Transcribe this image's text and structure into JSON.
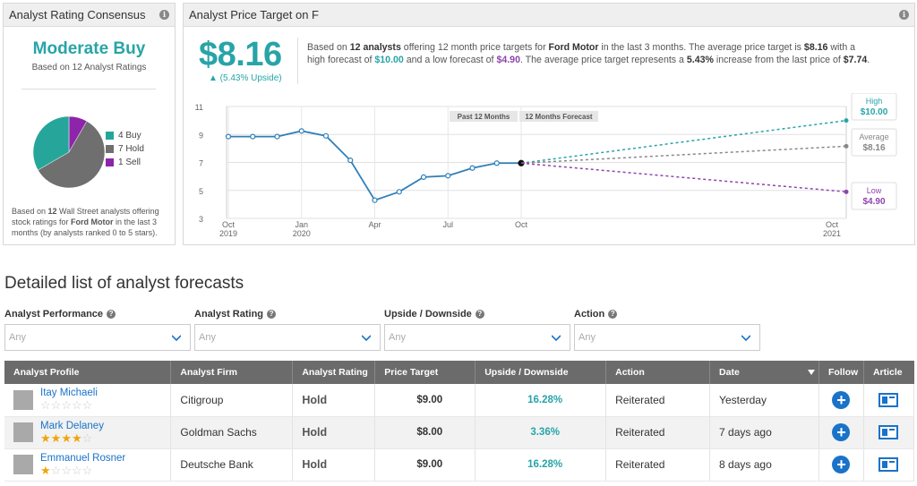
{
  "consensus": {
    "header": "Analyst Rating Consensus",
    "title": "Moderate Buy",
    "subtitle": "Based on 12 Analyst Ratings",
    "legend": [
      {
        "label": "4 Buy",
        "color": "#26a69a",
        "count": 4
      },
      {
        "label": "7 Hold",
        "color": "#6f6f6f",
        "count": 7
      },
      {
        "label": "1 Sell",
        "color": "#8e24aa",
        "count": 1
      }
    ],
    "footer_pre": "Based on ",
    "footer_count": "12",
    "footer_mid": " Wall Street analysts offering stock ratings for ",
    "footer_company": "Ford Motor",
    "footer_post": " in the last 3 months (by analysts ranked 0 to 5 stars)."
  },
  "price_target": {
    "header": "Analyst Price Target on F",
    "price": "$8.16",
    "upside": "▲ (5.43% Upside)",
    "text_1": "Based on ",
    "text_analysts": "12 analysts",
    "text_2": " offering 12 month price targets for ",
    "text_company": "Ford Motor",
    "text_3": " in the last 3 months. The average price target is ",
    "text_avg": "$8.16",
    "text_4": " with a high forecast of ",
    "text_high": "$10.00",
    "text_5": " and a low forecast of ",
    "text_low": "$4.90",
    "text_6": ". The average price target represents a ",
    "text_pct": "5.43%",
    "text_7": " increase from the last price of ",
    "text_last": "$7.74",
    "text_8": "."
  },
  "chart_data": {
    "type": "line",
    "y_ticks": [
      "11",
      "9",
      "7",
      "5",
      "3"
    ],
    "ylim": [
      3,
      11
    ],
    "x_ticks": [
      {
        "label": "Oct",
        "sub": "2019"
      },
      {
        "label": "Jan",
        "sub": "2020"
      },
      {
        "label": "Apr",
        "sub": ""
      },
      {
        "label": "Jul",
        "sub": ""
      },
      {
        "label": "Oct",
        "sub": ""
      },
      {
        "label": "Oct",
        "sub": "2021"
      }
    ],
    "period_labels": [
      "Past 12 Months",
      "12 Months Forecast"
    ],
    "history": [
      {
        "x": "Oct 2019",
        "y": 8.85
      },
      {
        "x": "Nov 2019",
        "y": 8.85
      },
      {
        "x": "Dec 2019",
        "y": 8.85
      },
      {
        "x": "Jan 2020",
        "y": 9.25
      },
      {
        "x": "Feb 2020",
        "y": 8.9
      },
      {
        "x": "Mar 2020",
        "y": 7.15
      },
      {
        "x": "Apr 2020",
        "y": 4.3
      },
      {
        "x": "May 2020",
        "y": 4.9
      },
      {
        "x": "Jun 2020",
        "y": 5.95
      },
      {
        "x": "Jul 2020",
        "y": 6.05
      },
      {
        "x": "Aug 2020",
        "y": 6.6
      },
      {
        "x": "Sep 2020",
        "y": 6.95
      },
      {
        "x": "Oct 2020",
        "y": 6.95
      }
    ],
    "forecasts": [
      {
        "name": "High",
        "value": "$10.00",
        "y": 10.0,
        "color": "#28a4a8"
      },
      {
        "name": "Average",
        "value": "$8.16",
        "y": 8.16,
        "color": "#888888"
      },
      {
        "name": "Low",
        "value": "$4.90",
        "y": 4.9,
        "color": "#8e44ad"
      }
    ]
  },
  "list": {
    "title": "Detailed list of analyst forecasts",
    "filters": [
      {
        "label": "Analyst Performance",
        "value": "Any"
      },
      {
        "label": "Analyst Rating",
        "value": "Any"
      },
      {
        "label": "Upside / Downside",
        "value": "Any"
      },
      {
        "label": "Action",
        "value": "Any"
      }
    ],
    "columns": [
      "Analyst Profile",
      "Analyst Firm",
      "Analyst Rating",
      "Price Target",
      "Upside / Downside",
      "Action",
      "Date",
      "Follow",
      "Article"
    ],
    "rows": [
      {
        "name": "Itay Michaeli",
        "stars": 0,
        "firm": "Citigroup",
        "rating": "Hold",
        "target": "$9.00",
        "upside": "16.28%",
        "action": "Reiterated",
        "date": "Yesterday"
      },
      {
        "name": "Mark Delaney",
        "stars": 4,
        "firm": "Goldman Sachs",
        "rating": "Hold",
        "target": "$8.00",
        "upside": "3.36%",
        "action": "Reiterated",
        "date": "7 days ago"
      },
      {
        "name": "Emmanuel Rosner",
        "stars": 1,
        "firm": "Deutsche Bank",
        "rating": "Hold",
        "target": "$9.00",
        "upside": "16.28%",
        "action": "Reiterated",
        "date": "8 days ago"
      }
    ]
  }
}
